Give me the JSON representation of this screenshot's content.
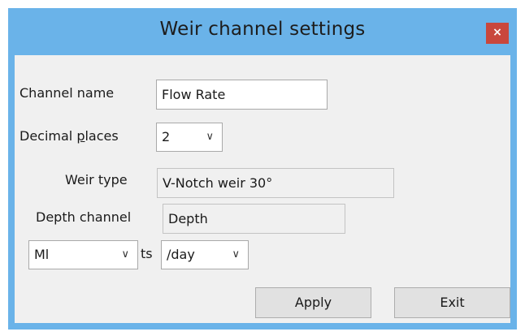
{
  "window": {
    "title": "Weir channel settings",
    "close_label": "×"
  },
  "form": {
    "channel_name_label": "Channel name",
    "channel_name_value": "Flow Rate",
    "decimal_places_label_pre": "Decimal ",
    "decimal_places_label_accel": "p",
    "decimal_places_label_post": "laces",
    "decimal_places_value": "2",
    "weir_type_label": "Weir type",
    "weir_type_value": "V-Notch weir 30°",
    "depth_channel_label": "Depth channel",
    "depth_channel_value": "Depth",
    "units_prefix_value": "Ml",
    "units_text": "ts",
    "units_rate_value": "/day"
  },
  "buttons": {
    "apply": "Apply",
    "exit": "Exit"
  },
  "icons": {
    "close": "close-icon",
    "dropdown": "chevron-down-icon"
  },
  "colors": {
    "titlebar": "#6ab3e9",
    "close_button": "#c9473c",
    "client_bg": "#f0f0f0"
  }
}
